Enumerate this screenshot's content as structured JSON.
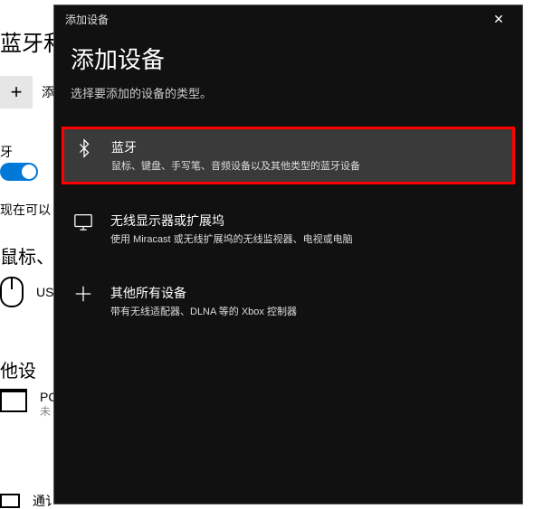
{
  "background": {
    "header": "蓝牙和",
    "add_label": "添",
    "bt_label": "牙",
    "discover": "现在可以",
    "section_mouse": "鼠标、",
    "mouse_item": "US",
    "section_other": "他设",
    "pc_line1": "PC",
    "pc_line2": "未",
    "last_item": "通讠"
  },
  "modal": {
    "titlebar": "添加设备",
    "heading": "添加设备",
    "subtitle": "选择要添加的设备的类型。",
    "options": {
      "bluetooth": {
        "title": "蓝牙",
        "desc": "鼠标、键盘、手写笔、音频设备以及其他类型的蓝牙设备"
      },
      "wireless": {
        "title": "无线显示器或扩展坞",
        "desc": "使用 Miracast 或无线扩展坞的无线监视器、电视或电脑"
      },
      "other": {
        "title": "其他所有设备",
        "desc": "带有无线适配器、DLNA 等的 Xbox 控制器"
      }
    }
  }
}
